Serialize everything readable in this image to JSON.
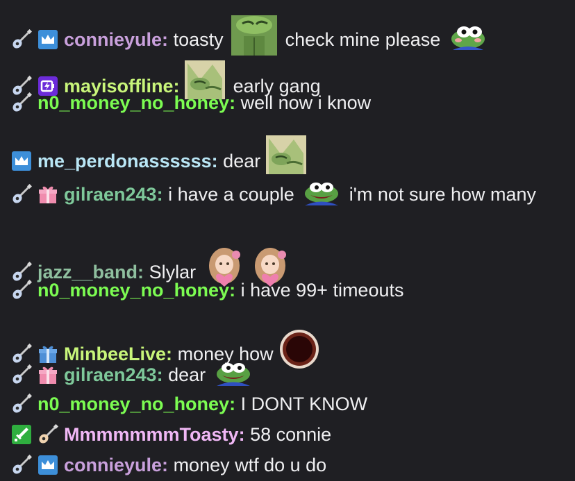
{
  "chat": {
    "messages": [
      {
        "user": "connieyule",
        "color": "#c9a0dc",
        "badges": [
          "guitar-badge",
          "crown-badge"
        ],
        "parts": [
          "toasty",
          "check mine please"
        ],
        "emotes": [
          "pepe-sip-emote",
          "pepe-blush-emote"
        ]
      },
      {
        "user": "mayisoffline",
        "color": "#c8f57a",
        "badges": [
          "guitar-badge",
          "prime-badge"
        ],
        "parts": [
          "",
          "early gang"
        ],
        "emotes": [
          "pepe-hug-emote"
        ]
      },
      {
        "user": "n0_money_no_honey",
        "color": "#7cfc52",
        "badges": [
          "guitar-badge"
        ],
        "parts": [
          "well now i know"
        ]
      },
      {
        "user": "me_perdonassssss",
        "color": "#b9e6f5",
        "badges": [
          "crown-badge"
        ],
        "parts": [
          "dear"
        ],
        "emotes": [
          "pepe-hug-emote"
        ]
      },
      {
        "user": "gilraen243",
        "color": "#7ec89a",
        "badges": [
          "guitar-badge",
          "gift-badge"
        ],
        "parts": [
          "i have a couple",
          "i'm not sure how many"
        ],
        "emotes": [
          "pepe-happy-emote"
        ]
      },
      {
        "user": "jazz__band",
        "color": "#8fbf9f",
        "badges": [
          "guitar-badge"
        ],
        "parts": [
          "Slylar"
        ],
        "emotes": [
          "girl-heart-emote",
          "girl-heart-emote"
        ]
      },
      {
        "user": "n0_money_no_honey",
        "color": "#7cfc52",
        "badges": [
          "guitar-badge"
        ],
        "parts": [
          "i have 99+ timeouts"
        ]
      },
      {
        "user": "MinbeeLive",
        "color": "#c8f57a",
        "badges": [
          "guitar-badge",
          "gift-blue-badge"
        ],
        "parts": [
          "money how"
        ],
        "emotes": [
          "donut-hole-emote"
        ]
      },
      {
        "user": "gilraen243",
        "color": "#7ec89a",
        "badges": [
          "guitar-badge",
          "gift-badge"
        ],
        "parts": [
          "dear"
        ],
        "emotes": [
          "pepe-happy-emote"
        ]
      },
      {
        "user": "n0_money_no_honey",
        "color": "#7cfc52",
        "badges": [
          "guitar-badge"
        ],
        "parts": [
          "I DONT KNOW"
        ]
      },
      {
        "user": "MmmmmmmToasty",
        "color": "#f0b7f5",
        "badges": [
          "sword-badge",
          "guitar-tan-badge"
        ],
        "parts": [
          "58 connie"
        ]
      },
      {
        "user": "connieyule",
        "color": "#c9a0dc",
        "badges": [
          "guitar-badge",
          "crown-badge"
        ],
        "parts": [
          "money wtf do u do"
        ]
      }
    ]
  }
}
